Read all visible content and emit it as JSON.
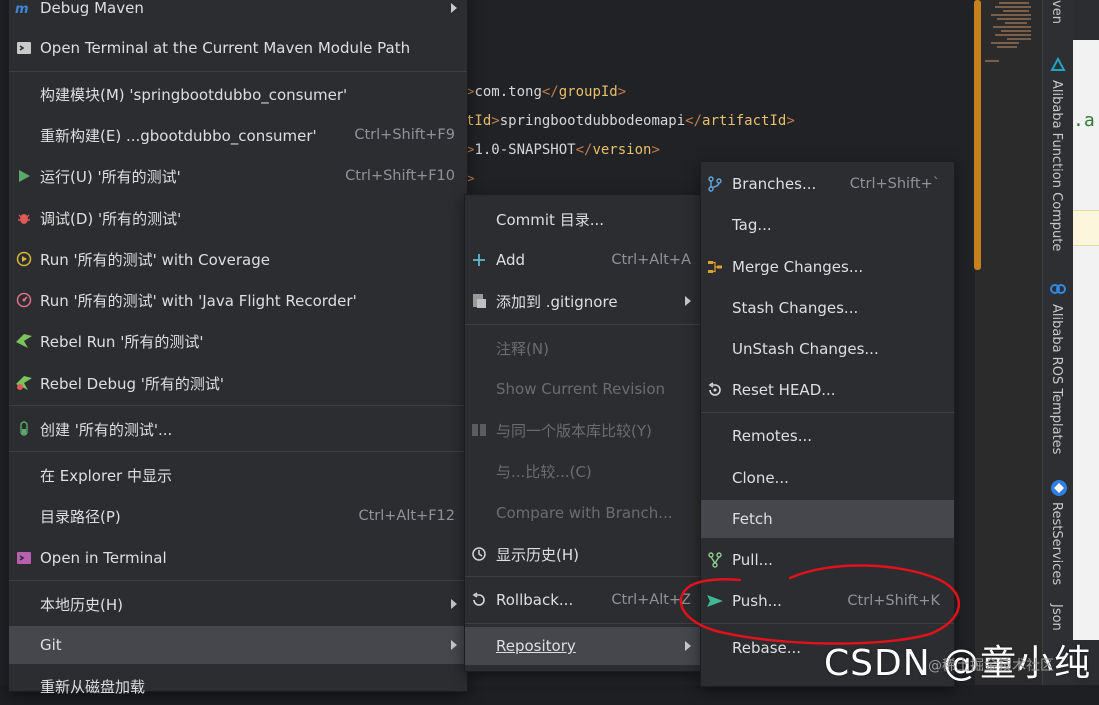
{
  "editor": {
    "line1": {
      "open": "com.tong",
      "close": "groupId"
    },
    "line2": {
      "open": "tId",
      "value": "springbootdubbodeomapi",
      "close": "artifactId"
    },
    "line3": {
      "value": "1.0-SNAPSHOT",
      "close": "version"
    },
    "right_edge_text": ".a"
  },
  "tool_windows": {
    "maven": "ven",
    "fc": "Alibaba Function Compute",
    "ros": "Alibaba ROS Templates",
    "rest": "RestServices",
    "json": "Json"
  },
  "context_menu": {
    "items": [
      {
        "label": "Debug Maven",
        "icon": "maven-debug-icon"
      },
      {
        "label": "Open Terminal at the Current Maven Module Path",
        "icon": "terminal-icon"
      },
      {
        "label": "构建模块(M) 'springbootdubbo_consumer'"
      },
      {
        "label": "重新构建(E) ...gbootdubbo_consumer'",
        "shortcut": "Ctrl+Shift+F9"
      },
      {
        "label": "运行(U) '所有的测试'",
        "shortcut": "Ctrl+Shift+F10",
        "icon": "run-icon"
      },
      {
        "label": "调试(D) '所有的测试'",
        "icon": "debug-icon"
      },
      {
        "label": "Run '所有的测试' with Coverage",
        "icon": "coverage-icon"
      },
      {
        "label": "Run '所有的测试' with 'Java Flight Recorder'",
        "icon": "flight-recorder-icon"
      },
      {
        "label": "Rebel Run '所有的测试'",
        "icon": "rebel-run-icon"
      },
      {
        "label": "Rebel Debug '所有的测试'",
        "icon": "rebel-debug-icon"
      },
      {
        "label": "创建 '所有的测试'...",
        "icon": "test-tube-icon"
      },
      {
        "label": "在 Explorer 中显示"
      },
      {
        "label": "目录路径(P)",
        "shortcut": "Ctrl+Alt+F12"
      },
      {
        "label": "Open in Terminal",
        "icon": "terminal-icon"
      },
      {
        "label": "本地历史(H)"
      },
      {
        "label": "Git"
      },
      {
        "label": "重新从磁盘加载"
      }
    ]
  },
  "git_menu": {
    "items": [
      {
        "label": "Commit 目录..."
      },
      {
        "label": "Add",
        "shortcut": "Ctrl+Alt+A",
        "icon": "plus-icon"
      },
      {
        "label": "添加到 .gitignore",
        "icon": "gitignore-icon"
      },
      {
        "label": "注释(N)"
      },
      {
        "label": "Show Current Revision"
      },
      {
        "label": "与同一个版本库比较(Y)",
        "icon": "compare-icon"
      },
      {
        "label": "与...比较...(C)"
      },
      {
        "label": "Compare with Branch..."
      },
      {
        "label": "显示历史(H)",
        "icon": "history-icon"
      },
      {
        "label": "Rollback...",
        "shortcut": "Ctrl+Alt+Z",
        "icon": "rollback-icon"
      },
      {
        "label": "Repository"
      }
    ]
  },
  "repo_menu": {
    "items": [
      {
        "label": "Branches...",
        "shortcut": "Ctrl+Shift+`",
        "icon": "branch-icon"
      },
      {
        "label": "Tag..."
      },
      {
        "label": "Merge Changes...",
        "icon": "merge-icon"
      },
      {
        "label": "Stash Changes..."
      },
      {
        "label": "UnStash Changes..."
      },
      {
        "label": "Reset HEAD...",
        "icon": "reset-icon"
      },
      {
        "label": "Remotes..."
      },
      {
        "label": "Clone..."
      },
      {
        "label": "Fetch"
      },
      {
        "label": "Pull...",
        "icon": "pull-icon"
      },
      {
        "label": "Push...",
        "shortcut": "Ctrl+Shift+K",
        "icon": "push-icon"
      },
      {
        "label": "Rebase..."
      }
    ]
  },
  "watermark": {
    "main": "CSDN @童小纯",
    "sub": "@稀土掘金技术社区"
  },
  "colors": {
    "accent_green": "#4caf50",
    "selected_bg": "#45474c",
    "annotation_red": "#e0121b"
  }
}
